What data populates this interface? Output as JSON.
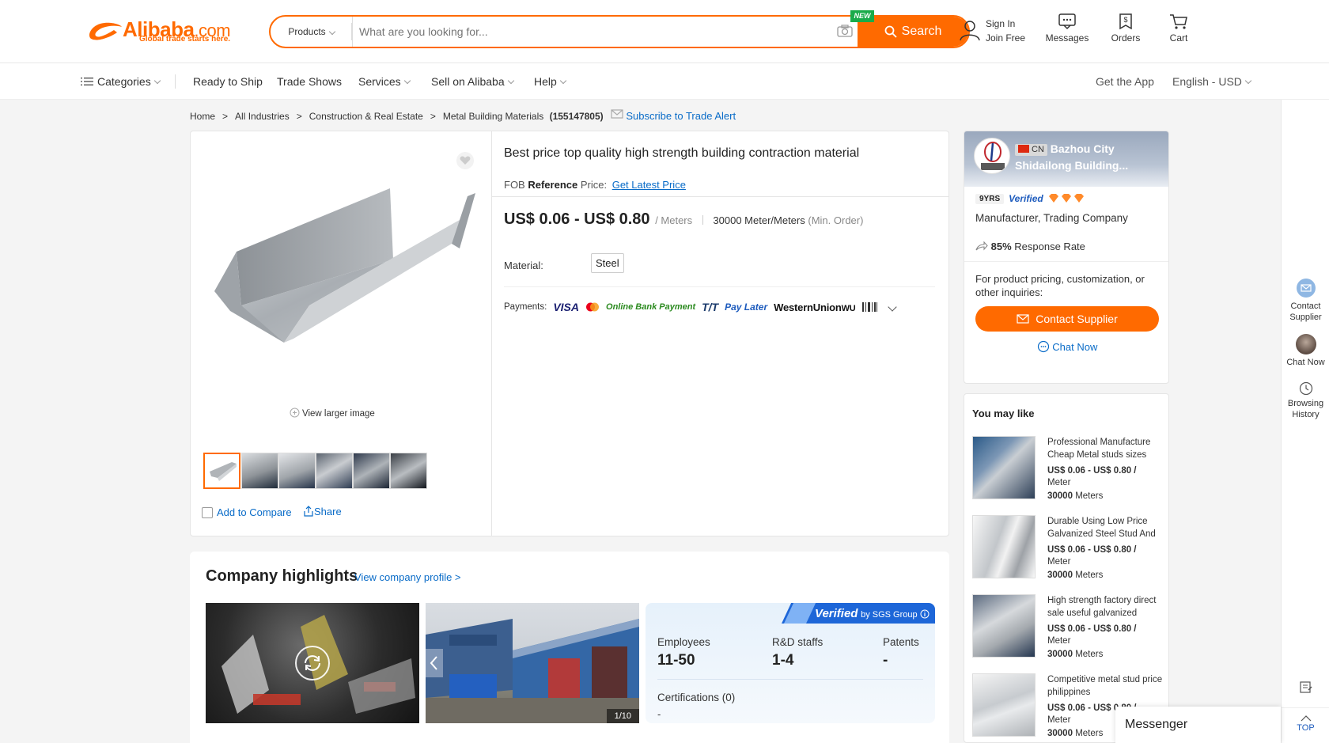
{
  "header": {
    "logo_text": "Alibaba",
    "logo_domain": ".com",
    "logo_tagline": "Global trade starts here.",
    "search_category": "Products",
    "search_placeholder": "What are you looking for...",
    "new_badge": "NEW",
    "search_button": "Search",
    "sign_in": "Sign In",
    "join_free": "Join Free",
    "messages": "Messages",
    "orders": "Orders",
    "cart": "Cart",
    "accent_color": "#ff6a00"
  },
  "nav": {
    "categories": "Categories",
    "items": [
      "Ready to Ship",
      "Trade Shows",
      "Services",
      "Sell on Alibaba",
      "Help"
    ],
    "get_app": "Get the App",
    "language": "English - USD"
  },
  "breadcrumb": {
    "items": [
      "Home",
      "All Industries",
      "Construction & Real Estate",
      "Metal Building Materials"
    ],
    "separator": ">",
    "count": "(155147805)",
    "subscribe": "Subscribe to Trade Alert"
  },
  "product": {
    "title": "Best price top quality high strength building contraction material",
    "fob_label": "FOB",
    "reference_label": "Reference",
    "price_label": "Price:",
    "get_latest_price": "Get Latest Price",
    "price_range": "US$ 0.06 - US$ 0.80",
    "price_unit": "/ Meters",
    "min_order_qty": "30000 Meter/Meters",
    "min_order_label": "(Min. Order)",
    "material_label": "Material:",
    "material_value": "Steel",
    "payments_label": "Payments:",
    "payment_methods": [
      "VISA",
      "Online Bank Payment",
      "T/T",
      "Pay Later",
      "WesternUnion",
      "WU"
    ],
    "view_larger": "View larger image",
    "add_to_compare": "Add to Compare",
    "share": "Share",
    "thumbnail_count": 6
  },
  "seller": {
    "country": "CN",
    "name": "Bazhou City Shidailong Building...",
    "years": "9YRS",
    "verified": "Verified",
    "business_type": "Manufacturer, Trading Company",
    "response_rate": "85%",
    "response_label": "Response Rate",
    "inquiry_text": "For product pricing, customization, or other inquiries:",
    "contact_button": "Contact Supplier",
    "chat_now": "Chat Now"
  },
  "you_may_like": {
    "title": "You may like",
    "items": [
      {
        "title": "Professional Manufacture Cheap Metal studs sizes",
        "price": "US$ 0.06 - US$ 0.80 /",
        "unit": "Meter",
        "moq_value": "30000",
        "moq_unit": "Meters"
      },
      {
        "title": "Durable Using Low Price Galvanized Steel Stud And",
        "price": "US$ 0.06 - US$ 0.80 /",
        "unit": "Meter",
        "moq_value": "30000",
        "moq_unit": "Meters"
      },
      {
        "title": "High strength factory direct sale useful galvanized",
        "price": "US$ 0.06 - US$ 0.80 /",
        "unit": "Meter",
        "moq_value": "30000",
        "moq_unit": "Meters"
      },
      {
        "title": "Competitive metal stud price philippines",
        "price": "US$ 0.06 - US$ 0.80 /",
        "unit": "Meter",
        "moq_value": "30000",
        "moq_unit": "Meters"
      }
    ]
  },
  "company": {
    "title": "Company highlights",
    "view_profile": "View company profile >",
    "photo_counter": "1/10",
    "verified_by": "Verified",
    "verified_by_suffix": "by SGS Group",
    "stats": [
      {
        "label": "Employees",
        "value": "11-50"
      },
      {
        "label": "R&D staffs",
        "value": "1-4"
      },
      {
        "label": "Patents",
        "value": "-"
      }
    ],
    "certifications_label": "Certifications (0)",
    "certifications_value": "-"
  },
  "rail": {
    "contact_supplier": "Contact Supplier",
    "chat_now": "Chat Now",
    "browsing_history": "Browsing History",
    "top": "TOP"
  },
  "messenger": "Messenger"
}
